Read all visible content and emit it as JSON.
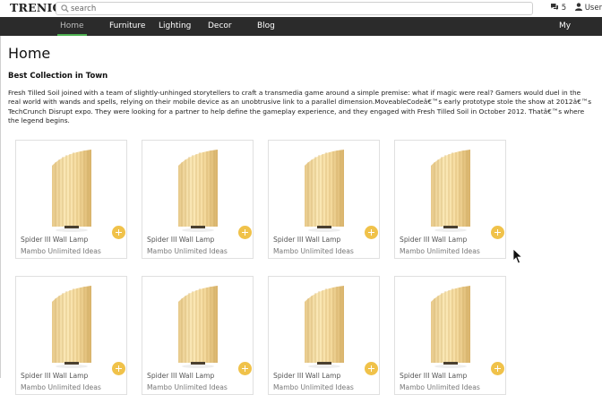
{
  "header": {
    "logo": "TRENIQ",
    "search_placeholder": "search",
    "messages_count": "5",
    "user_label": "User"
  },
  "nav": {
    "items": [
      {
        "label": "Home",
        "active": true
      },
      {
        "label": "Furniture"
      },
      {
        "label": "Lighting"
      },
      {
        "label": "Decor"
      },
      {
        "label": "Blog"
      },
      {
        "label": "My"
      }
    ]
  },
  "page": {
    "title": "Home",
    "subtitle": "Best Collection in Town",
    "intro": "Fresh Tilled Soil joined with a team of slightly-unhinged storytellers to craft a transmedia game around a simple premise: what if magic were real? Gamers would duel in the real world with wands and spells, relying on their mobile device as an unobtrusive link to a parallel dimension.MoveableCodeâ€™s early prototype stole the show at 2012â€™s TechCrunch Disrupt expo. They were looking for a partner to help define the gameplay experience, and they engaged with Fresh Tilled Soil in October 2012. Thatâ€™s where the legend begins."
  },
  "products": [
    {
      "name": "Spider III Wall Lamp",
      "maker": "Mambo Unlimited Ideas"
    },
    {
      "name": "Spider III Wall Lamp",
      "maker": "Mambo Unlimited Ideas"
    },
    {
      "name": "Spider III Wall Lamp",
      "maker": "Mambo Unlimited Ideas"
    },
    {
      "name": "Spider III Wall Lamp",
      "maker": "Mambo Unlimited Ideas"
    },
    {
      "name": "Spider III Wall Lamp",
      "maker": "Mambo Unlimited Ideas"
    },
    {
      "name": "Spider III Wall Lamp",
      "maker": "Mambo Unlimited Ideas"
    },
    {
      "name": "Spider III Wall Lamp",
      "maker": "Mambo Unlimited Ideas"
    },
    {
      "name": "Spider III Wall Lamp",
      "maker": "Mambo Unlimited Ideas"
    }
  ],
  "colors": {
    "nav_bg": "#2b2b2b",
    "active_underline": "#4caf50",
    "add_button": "#f0c24a"
  }
}
